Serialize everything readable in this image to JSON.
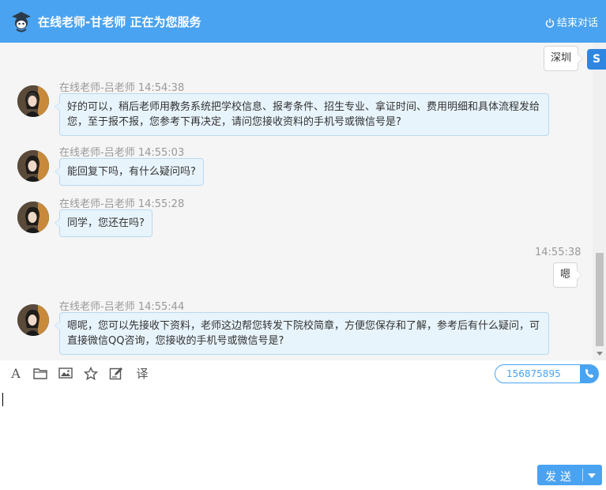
{
  "header": {
    "title": "在线老师-甘老师 正在为您服务",
    "end_label": "结束对话"
  },
  "side_badge": "S",
  "messages": [
    {
      "dir": "out",
      "text": "深圳"
    },
    {
      "dir": "in",
      "meta": "在线老师-吕老师 14:54:38",
      "text": "好的可以，稍后老师用教务系统把学校信息、报考条件、招生专业、拿证时间、费用明细和具体流程发给您，至于报不报，您参考下再决定，请问您接收资料的手机号或微信号是?"
    },
    {
      "dir": "in",
      "meta": "在线老师-吕老师 14:55:03",
      "text": "能回复下吗，有什么疑问吗?"
    },
    {
      "dir": "in",
      "meta": "在线老师-吕老师 14:55:28",
      "text": "同学，您还在吗?"
    },
    {
      "dir": "out",
      "meta": "14:55:38",
      "text": "嗯"
    },
    {
      "dir": "in",
      "meta": "在线老师-吕老师 14:55:44",
      "text": "嗯呢，您可以先接收下资料，老师这边帮您转发下院校简章，方便您保存和了解，参考后有什么疑问，可直接微信QQ咨询，您接收的手机号或微信号是?"
    }
  ],
  "toolbar": {
    "font_glyph": "A",
    "translate_label": "译",
    "phone_value": "156875895"
  },
  "send": {
    "label": "发送"
  },
  "colors": {
    "brand": "#4aa3f0",
    "bubble_in": "#e8f4fc"
  }
}
